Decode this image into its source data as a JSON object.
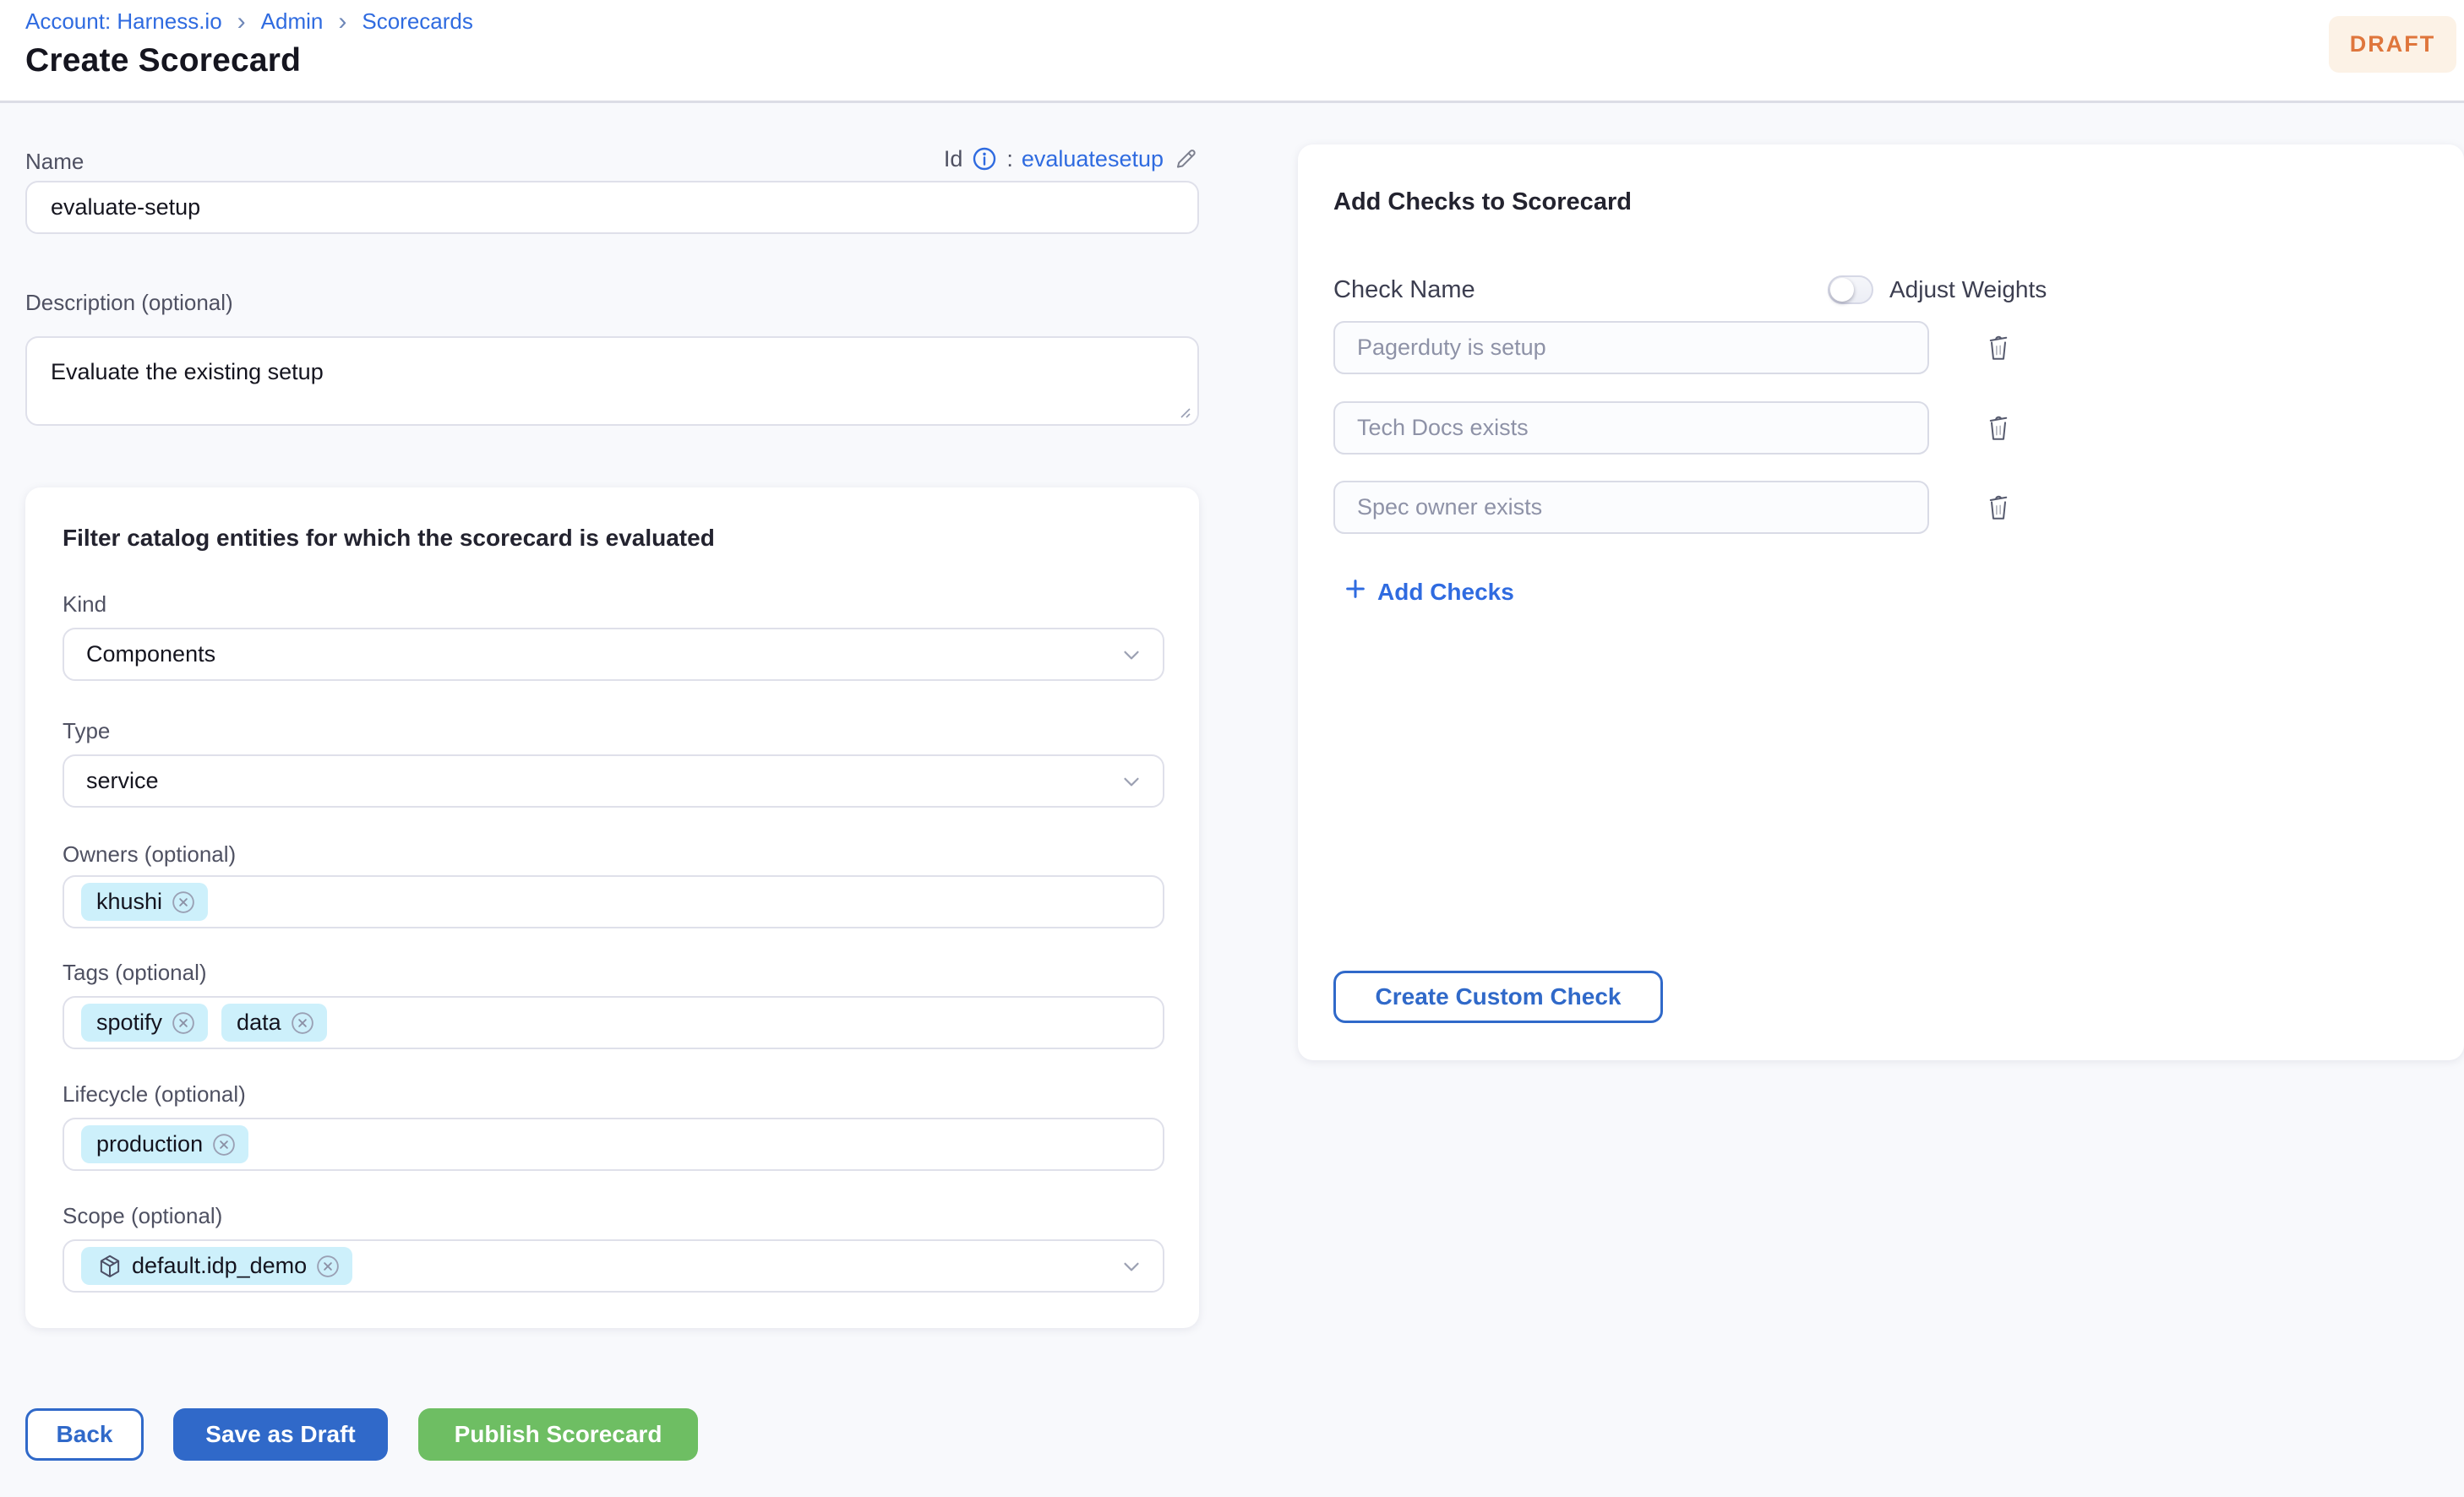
{
  "breadcrumb": {
    "items": [
      "Account: Harness.io",
      "Admin",
      "Scorecards"
    ],
    "separator": "›"
  },
  "header": {
    "title": "Create Scorecard",
    "status_badge": "DRAFT"
  },
  "form": {
    "name": {
      "label": "Name",
      "value": "evaluate-setup"
    },
    "id_row": {
      "label": "Id",
      "separator": ":",
      "value": "evaluatesetup"
    },
    "description": {
      "label": "Description (optional)",
      "value": "Evaluate the existing setup"
    },
    "filter": {
      "title": "Filter catalog entities for which the scorecard is evaluated",
      "kind": {
        "label": "Kind",
        "value": "Components"
      },
      "type": {
        "label": "Type",
        "value": "service"
      },
      "owners": {
        "label": "Owners (optional)",
        "chips": [
          "khushi"
        ]
      },
      "tags": {
        "label": "Tags (optional)",
        "chips": [
          "spotify",
          "data"
        ]
      },
      "lifecycle": {
        "label": "Lifecycle (optional)",
        "chips": [
          "production"
        ]
      },
      "scope": {
        "label": "Scope (optional)",
        "chips": [
          "default.idp_demo"
        ]
      }
    },
    "actions": {
      "back": "Back",
      "save_draft": "Save as Draft",
      "publish": "Publish Scorecard"
    }
  },
  "checks_panel": {
    "title": "Add Checks to Scorecard",
    "check_name_label": "Check Name",
    "adjust_weights_label": "Adjust Weights",
    "adjust_weights_on": false,
    "checks": [
      "Pagerduty is setup",
      "Tech Docs exists",
      "Spec owner exists"
    ],
    "add_checks_label": "Add Checks",
    "create_custom_check": "Create Custom Check"
  },
  "colors": {
    "accent_blue": "#2f6be0",
    "button_blue": "#3069c9",
    "button_green": "#6ebe63",
    "draft_text": "#df763c",
    "draft_bg": "#fcf2e6",
    "chip_bg": "#cdf0fb",
    "page_bg": "#f8f9fc",
    "card_bg": "#ffffff",
    "border": "#dfe0ea",
    "label_text": "#4f5162",
    "title_text": "#1d1d2c",
    "muted_text": "#8e92a7"
  }
}
